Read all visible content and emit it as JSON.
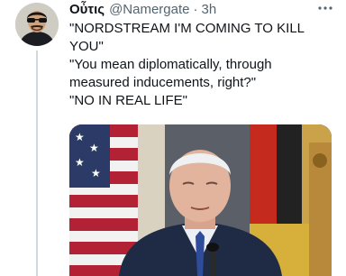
{
  "tweet": {
    "display_name": "Οὖτις",
    "handle": "@Namergate",
    "separator": "·",
    "time": "3h",
    "more_icon": "more-horizontal-icon",
    "lines": [
      "\"NORDSTREAM I'M COMING TO KILL YOU\"",
      "\"You mean diplomatically, through measured inducements, right?\"",
      "\"NO IN REAL LIFE\""
    ]
  },
  "colors": {
    "text_primary": "#0f1419",
    "text_secondary": "#536471",
    "thread_line": "#cfd9de"
  }
}
